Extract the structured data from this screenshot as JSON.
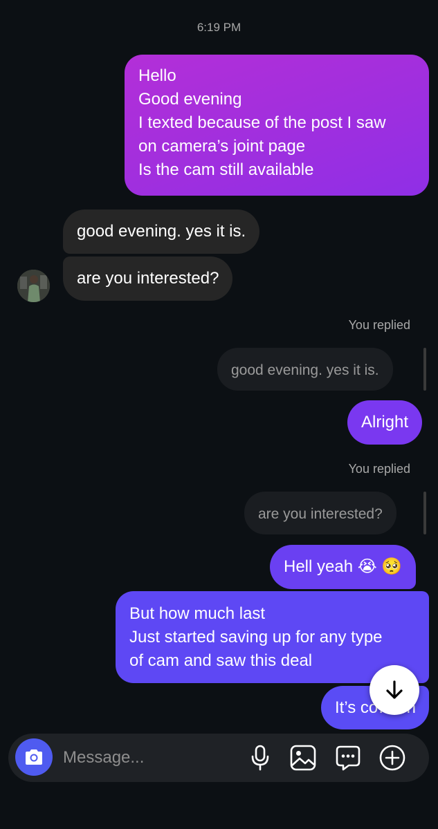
{
  "thread": {
    "timestamp": "6:19 PM",
    "messages": {
      "sent_1": {
        "lines": [
          "Hello",
          "Good evening",
          "I texted because of the post I saw",
          "on camera’s joint page",
          "Is the cam still available"
        ]
      },
      "recv_1": {
        "text": "good evening. yes it is."
      },
      "recv_2": {
        "text": "are you interested?"
      },
      "reply_1": {
        "label": "You replied",
        "quoted": "good evening. yes it is.",
        "text": "Alright"
      },
      "reply_2": {
        "label": "You replied",
        "quoted": "are you interested?",
        "text": "Hell yeah 😭 🥺"
      },
      "sent_2": {
        "lines": [
          "But how much last",
          "Just started saving up for any type",
          "of cam and saw this deal"
        ]
      },
      "sent_3": {
        "text": "It’s co…ish"
      }
    }
  },
  "composer": {
    "placeholder": "Message...",
    "icons": [
      "camera-icon",
      "microphone-icon",
      "gallery-icon",
      "sticker-icon",
      "plus-icon"
    ]
  },
  "colors": {
    "background": "#0c1014",
    "received_bubble": "#262626",
    "sent_gradient_top": "#b22fd6",
    "sent_gradient_mid": "#8a2fe8",
    "sent_gradient_bottom": "#5b4cf5",
    "camera_button": "#4f5bf0"
  }
}
